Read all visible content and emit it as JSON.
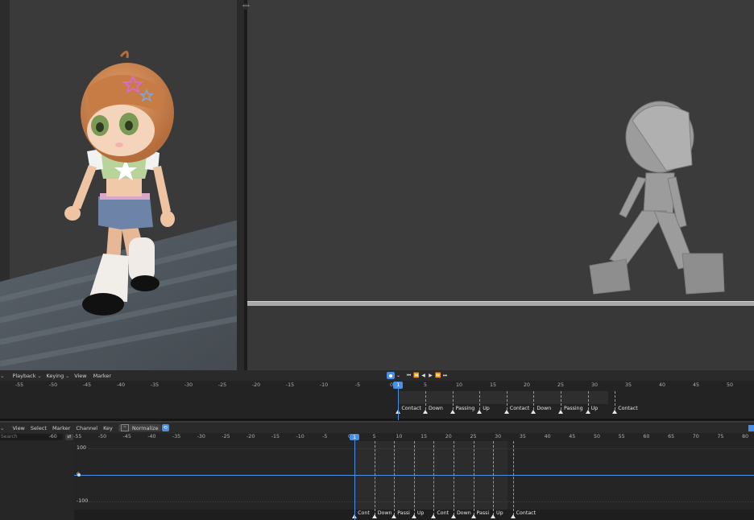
{
  "timeline": {
    "menu": [
      "Playback",
      "Keying",
      "View",
      "Marker"
    ],
    "current_frame": "1",
    "ruler_ticks": [
      "-55",
      "-50",
      "-45",
      "-40",
      "-35",
      "-30",
      "-25",
      "-20",
      "-15",
      "-10",
      "-5",
      "0",
      "5",
      "10",
      "15",
      "20",
      "25",
      "30",
      "35",
      "40",
      "45",
      "50"
    ],
    "markers": [
      "Contact",
      "Down",
      "Passing",
      "Up",
      "Contact",
      "Down",
      "Passing",
      "Up",
      "Contact"
    ],
    "controls": [
      "⏺",
      "⌄",
      "⏮",
      "⏪",
      "◀",
      "▶",
      "⏩",
      "⏭"
    ]
  },
  "graph_editor": {
    "menu": [
      "View",
      "Select",
      "Marker",
      "Channel",
      "Key"
    ],
    "normalize_label": "Normalize",
    "search_placeholder": "Search",
    "current_frame": "1",
    "ruler_ticks": [
      "-60",
      "-55",
      "-50",
      "-45",
      "-40",
      "-35",
      "-30",
      "-25",
      "-20",
      "-15",
      "-10",
      "-5",
      "0",
      "5",
      "10",
      "15",
      "20",
      "25",
      "30",
      "35",
      "40",
      "45",
      "50",
      "55",
      "60",
      "65",
      "70",
      "75",
      "80"
    ],
    "y_labels": [
      "100",
      "0",
      "-100"
    ],
    "markers": [
      "Cont",
      "Down",
      "Passi",
      "Up",
      "Cont",
      "Down",
      "Passi",
      "Up",
      "Contact"
    ]
  },
  "colors": {
    "accent": "#4a90e2"
  }
}
